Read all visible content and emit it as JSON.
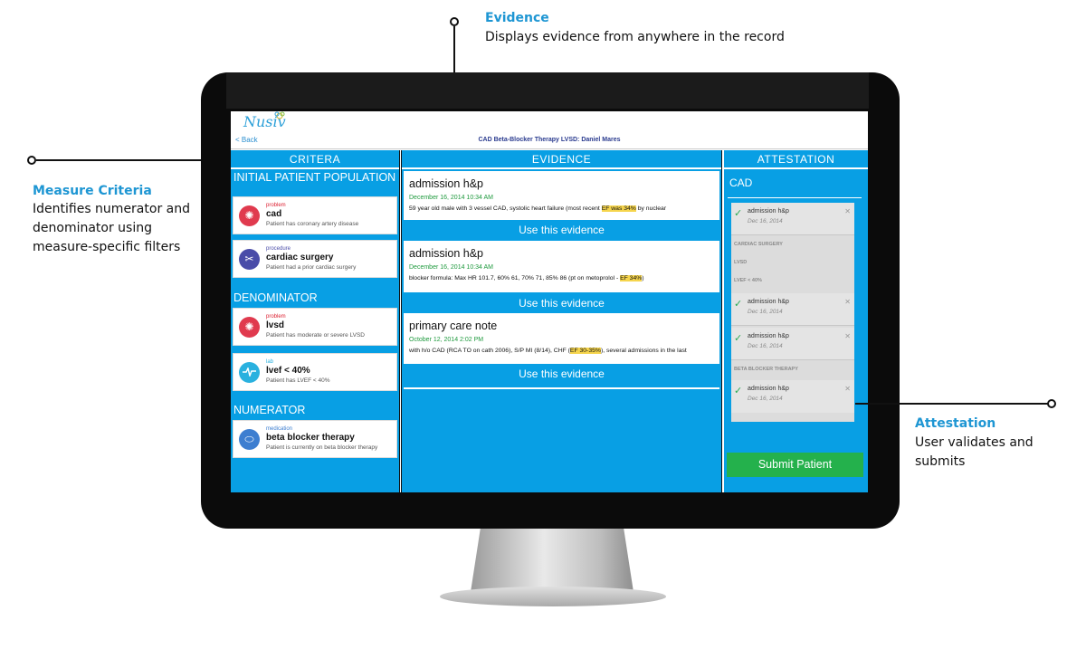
{
  "callouts": {
    "evidence": {
      "title": "Evidence",
      "desc": "Displays evidence from anywhere in the record"
    },
    "criteria": {
      "title": "Measure Criteria",
      "desc_lines": [
        "Identifies numerator and",
        "denominator using",
        "measure-specific filters"
      ]
    },
    "attestation": {
      "title": "Attestation",
      "desc": "User validates and submits"
    }
  },
  "app": {
    "logo": "Nusiv",
    "back_label": "< Back",
    "page_title": "CAD Beta-Blocker Therapy LVSD: Daniel Mares"
  },
  "criteria": {
    "header": "CRITERA",
    "sections": [
      {
        "title": "INITIAL PATIENT POPULATION",
        "items": [
          {
            "type": "problem",
            "name": "cad",
            "desc": "Patient has coronary artery disease",
            "icon": "virus-icon",
            "color": "#e03a4e"
          },
          {
            "type": "procedure",
            "name": "cardiac surgery",
            "desc": "Patient had a prior cardiac surgery",
            "icon": "scissors-icon",
            "color": "#4a4ca8"
          }
        ]
      },
      {
        "title": "DENOMINATOR",
        "items": [
          {
            "type": "problem",
            "name": "lvsd",
            "desc": "Patient has moderate or severe LVSD",
            "icon": "virus-icon",
            "color": "#e03a4e"
          },
          {
            "type": "lab",
            "name": "lvef < 40%",
            "desc": "Patient has LVEF < 40%",
            "icon": "pulse-icon",
            "color": "#2ab1df"
          }
        ]
      },
      {
        "title": "NUMERATOR",
        "items": [
          {
            "type": "medication",
            "name": "beta blocker therapy",
            "desc": "Patient is currently on beta blocker therapy",
            "icon": "pill-icon",
            "color": "#3d7ed0"
          }
        ]
      }
    ]
  },
  "evidence": {
    "header": "EVIDENCE",
    "use_label": "Use this evidence",
    "items": [
      {
        "title": "admission h&p",
        "date": "December 16, 2014 10:34 AM",
        "pre": "59 year old male with 3 vessel CAD, systolic heart failure (most recent ",
        "highlight": "EF was 34%",
        "post": " by nuclear"
      },
      {
        "title": "admission h&p",
        "date": "December 16, 2014 10:34 AM",
        "pre": "blocker formula: Max HR 101.7, 60% 61, 70% 71, 85% 86 (pt on metoprolol - ",
        "highlight": "EF 34%",
        "post": ")"
      },
      {
        "title": "primary care note",
        "date": "October 12, 2014 2:02 PM",
        "pre": "with h/o CAD (RCA TO on cath 2006), S/P MI (8/14), CHF (",
        "highlight": "EF 30-35%",
        "post": "), several admissions in the last"
      }
    ]
  },
  "attestation": {
    "header": "ATTESTATION",
    "title": "CAD",
    "entries": [
      {
        "name": "admission h&p",
        "date": "Dec 16, 2014"
      },
      {
        "label": "CARDIAC SURGERY"
      },
      {
        "label": "LVSD"
      },
      {
        "label": "LVEF < 40%"
      },
      {
        "name": "admission h&p",
        "date": "Dec 16, 2014"
      },
      {
        "name": "admission h&p",
        "date": "Dec 16, 2014"
      },
      {
        "label": "BETA BLOCKER THERAPY"
      },
      {
        "name": "admission h&p",
        "date": "Dec 16, 2014"
      }
    ],
    "submit_label": "Submit Patient"
  },
  "colors": {
    "accent": "#089fe4",
    "submit": "#24b14c",
    "highlight": "#f6d54d",
    "callout": "#1e96d3"
  }
}
